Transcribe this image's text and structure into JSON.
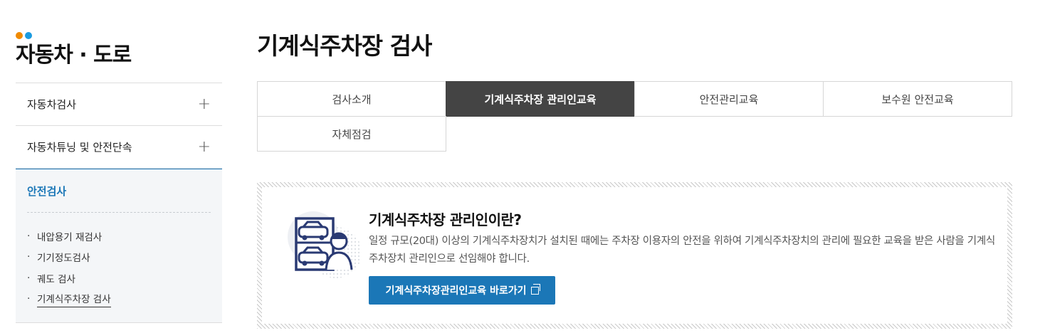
{
  "colors": {
    "accent": "#1b77b7",
    "dot1": "#f08a00",
    "dot2": "#1b9be0",
    "tab_active_bg": "#444444"
  },
  "sidebar": {
    "title": "자동차 · 도로",
    "items": [
      {
        "label": "자동차검사",
        "icon": "plus-icon",
        "toggle": "+"
      },
      {
        "label": "자동차튜닝 및 안전단속",
        "icon": "plus-icon",
        "toggle": "+"
      }
    ],
    "active": {
      "label": "안전검사",
      "sub_items": [
        {
          "label": "내압용기 재검사",
          "bullet": "·"
        },
        {
          "label": "기기정도검사",
          "bullet": "·"
        },
        {
          "label": "궤도 검사",
          "bullet": "·"
        },
        {
          "label": "기계식주차장 검사",
          "bullet": "·",
          "current": true
        }
      ]
    }
  },
  "main": {
    "title": "기계식주차장 검사",
    "tabs": [
      {
        "label": "검사소개",
        "active": false
      },
      {
        "label": "기계식주차장 관리인교육",
        "active": true
      },
      {
        "label": "안전관리교육",
        "active": false
      },
      {
        "label": "보수원 안전교육",
        "active": false
      },
      {
        "label": "자체점검",
        "active": false
      }
    ],
    "info": {
      "title": "기계식주차장 관리인이란?",
      "description": "일정 규모(20대) 이상의 기계식주차장치가 설치된 때에는 주차장 이용자의 안전을 위하여 기계식주차장치의 관리에 필요한 교육을 받은 사람을 기계식주차장치 관리인으로 선임해야 합니다.",
      "button_label": "기계식주차장관리인교육 바로가기",
      "button_icon": "external-link-icon",
      "illustration": "parking-manager-icon"
    }
  }
}
